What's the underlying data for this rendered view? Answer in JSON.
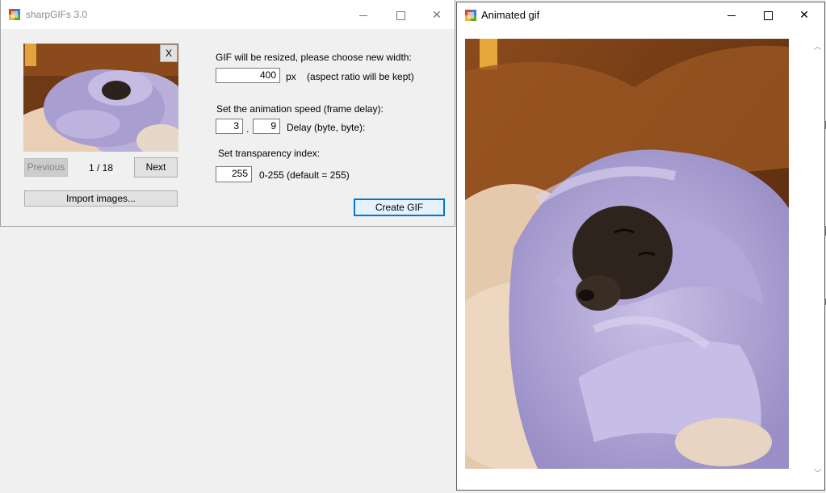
{
  "main_window": {
    "title": "sharpGIFs 3.0",
    "thumbnail_close_label": "X",
    "previous_label": "Previous",
    "page_indicator": "1 / 18",
    "next_label": "Next",
    "import_label": "Import images...",
    "width_prompt": "GIF will be resized, please choose new width:",
    "width_value": "400",
    "width_unit": "px",
    "aspect_note": "(aspect ratio will be kept)",
    "speed_prompt": "Set the animation speed (frame delay):",
    "delay_first": "3",
    "delay_separator": ".",
    "delay_second": "9",
    "delay_note": "Delay (byte, byte):",
    "transparency_prompt": "Set transparency index:",
    "transparency_value": "255",
    "transparency_note": "0-255 (default = 255)",
    "create_label": "Create GIF"
  },
  "gif_window": {
    "title": "Animated gif"
  },
  "colors": {
    "focus_accent": "#0078d7",
    "window_bg": "#f0f0f0",
    "blanket": "#b3a8d6",
    "leather": "#7a3d14"
  },
  "icons": [
    "app-icon",
    "minimize-icon",
    "maximize-icon",
    "close-icon",
    "scroll-up-icon",
    "scroll-down-icon"
  ]
}
